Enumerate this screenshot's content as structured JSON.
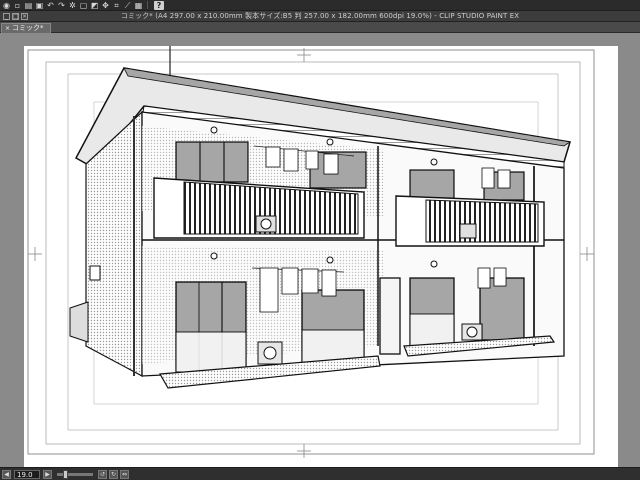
{
  "toolbar": {
    "buttons": [
      {
        "name": "eye-icon",
        "glyph": "◉"
      },
      {
        "name": "new-file-icon",
        "glyph": "▫"
      },
      {
        "name": "open-file-icon",
        "glyph": "▤"
      },
      {
        "name": "save-icon",
        "glyph": "▣"
      },
      {
        "name": "undo-icon",
        "glyph": "↶"
      },
      {
        "name": "redo-icon",
        "glyph": "↷"
      },
      {
        "name": "settings-icon",
        "glyph": "✲"
      },
      {
        "name": "clear-icon",
        "glyph": "▢"
      },
      {
        "name": "fill-icon",
        "glyph": "◩"
      },
      {
        "name": "transform-icon",
        "glyph": "✥"
      },
      {
        "name": "snap-icon",
        "glyph": "⌗"
      },
      {
        "name": "ruler-icon",
        "glyph": "⟋"
      },
      {
        "name": "grid-icon",
        "glyph": "▦"
      }
    ],
    "help_label": "?"
  },
  "window": {
    "title": "コミック* (A4 297.00 x 210.00mm 製本サイズ:B5 判 257.00 x 182.00mm 600dpi 19.0%) - CLIP STUDIO PAINT EX",
    "controls": [
      "_",
      "□",
      "×"
    ]
  },
  "tab": {
    "label": "コミック*",
    "close_glyph": "×"
  },
  "status": {
    "zoom_value": "19.0",
    "zoom_fraction": 0.19,
    "buttons": [
      "◀",
      "▶"
    ],
    "rotate_buttons": [
      "↺",
      "↻",
      "⇔"
    ]
  },
  "colors": {
    "ui_dark": "#2b2b2b",
    "canvas_gray": "#8a8a8a",
    "paper": "#ffffff",
    "ink": "#111111",
    "screentone": "#b8b8b8"
  }
}
